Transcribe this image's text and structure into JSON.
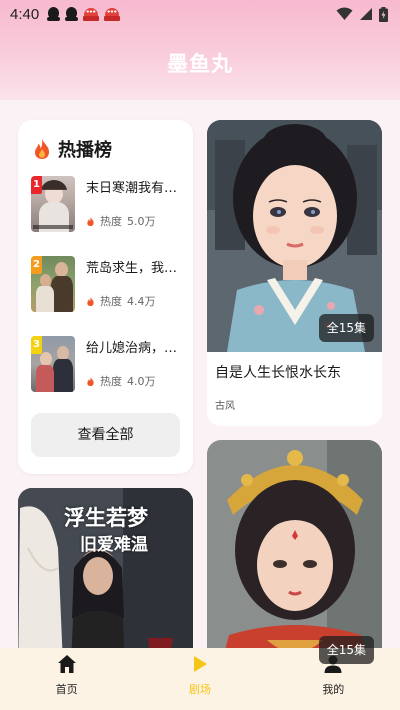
{
  "status_bar": {
    "time": "4:40"
  },
  "app": {
    "title": "墨鱼丸"
  },
  "hot_list": {
    "title": "热播榜",
    "items": [
      {
        "rank": "1",
        "name": "末日寒潮我有…",
        "heat_label": "热度",
        "heat_value": "5.0万",
        "rank_color": "#e8262b"
      },
      {
        "rank": "2",
        "name": "荒岛求生，我…",
        "heat_label": "热度",
        "heat_value": "4.4万",
        "rank_color": "#f59b1d"
      },
      {
        "rank": "3",
        "name": "给儿媳治病，…",
        "heat_label": "热度",
        "heat_value": "4.0万",
        "rank_color": "#f5d20f"
      }
    ],
    "view_all_label": "查看全部"
  },
  "dramas": [
    {
      "name": "自是人生长恨水长东",
      "tag": "古风",
      "episodes": "全15集"
    },
    {
      "name": "",
      "tag": "",
      "episodes": "全15集"
    }
  ],
  "poster": {
    "line1": "浮生若梦",
    "line2": "旧爱难温"
  },
  "bottom_nav": [
    {
      "label": "首页",
      "icon": "home-icon",
      "active": false
    },
    {
      "label": "剧场",
      "icon": "play-icon",
      "active": true
    },
    {
      "label": "我的",
      "icon": "user-icon",
      "active": false
    }
  ],
  "colors": {
    "accent": "#f5c518",
    "header": "#f7b9cf"
  }
}
